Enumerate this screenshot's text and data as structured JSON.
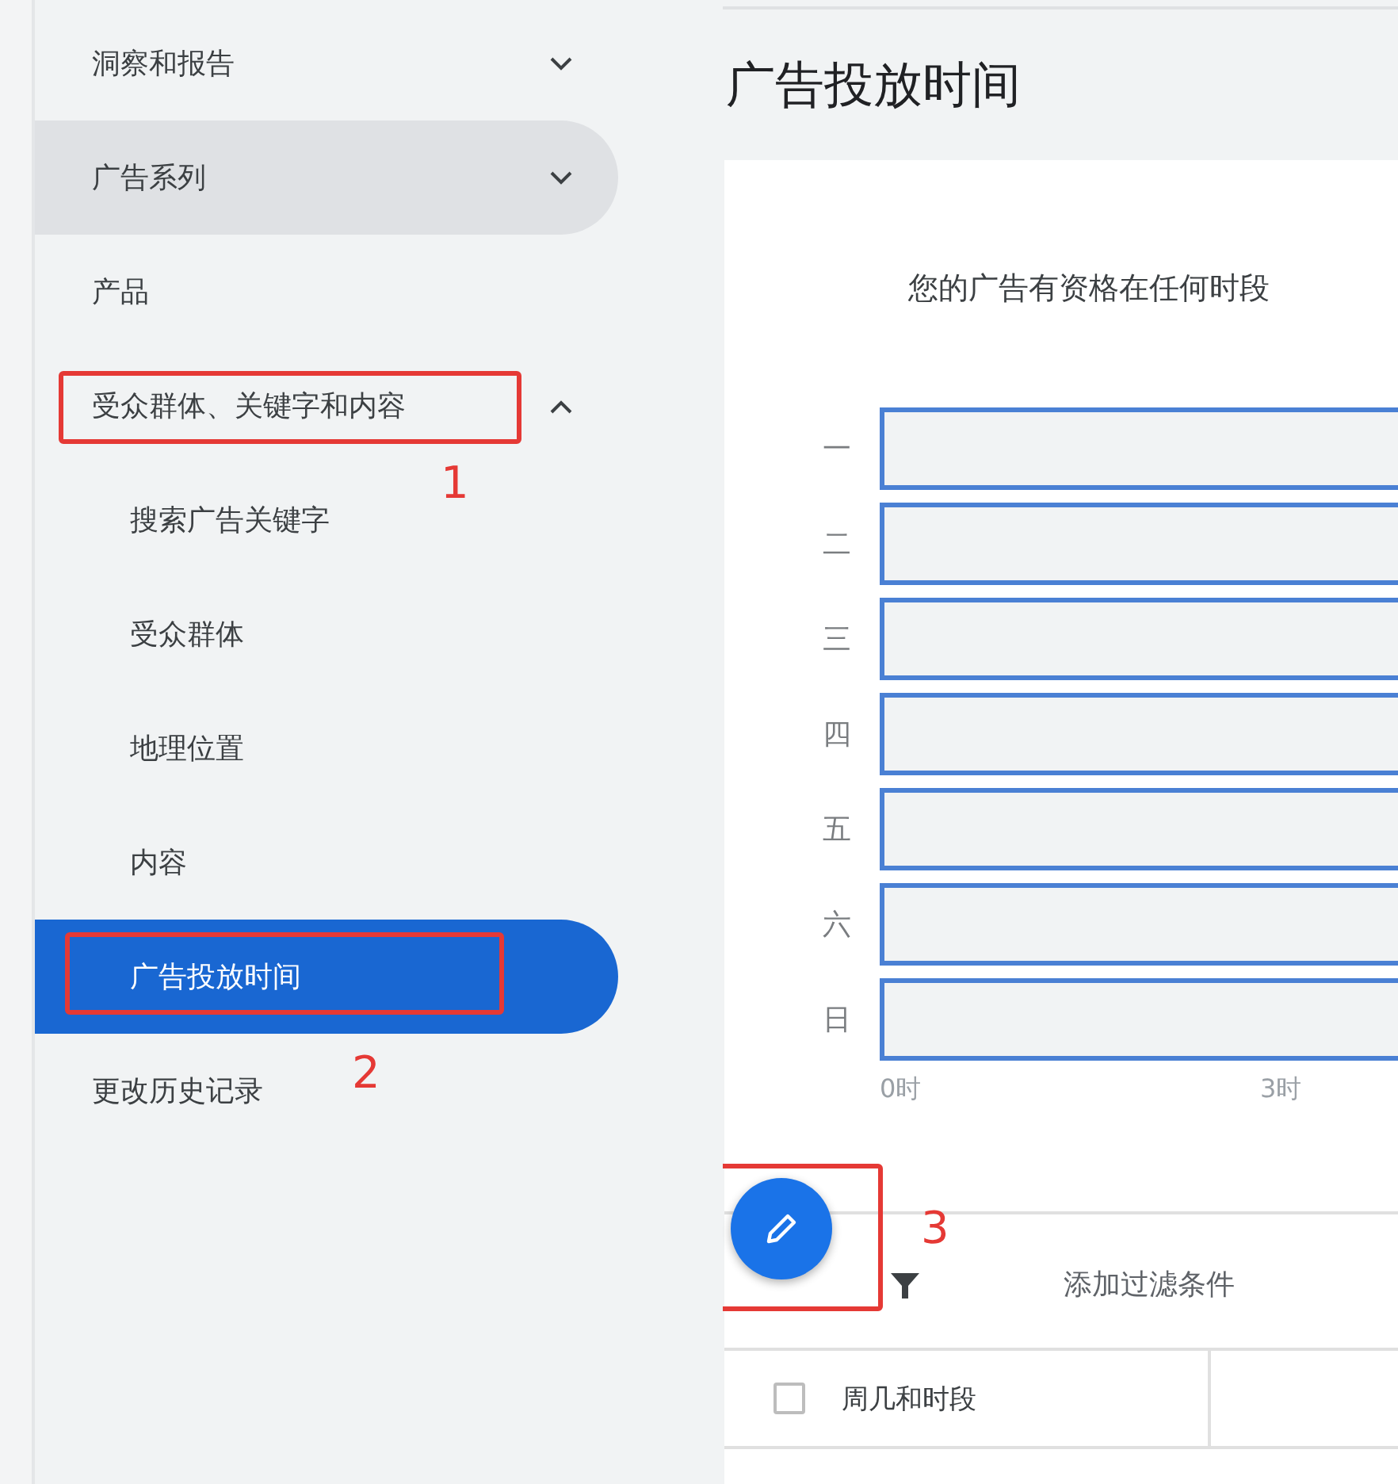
{
  "sidebar": {
    "items": [
      {
        "label": "洞察和报告",
        "expanded": false,
        "selected": false,
        "highlighted": false
      },
      {
        "label": "广告系列",
        "expanded": false,
        "selected": false,
        "highlighted": true
      },
      {
        "label": "产品",
        "selected": false,
        "highlighted": false
      },
      {
        "label": "受众群体、关键字和内容",
        "expanded": true,
        "selected": false,
        "highlighted": false,
        "annotation": "1",
        "children": [
          {
            "label": "搜索广告关键字",
            "selected": false,
            "highlighted": false
          },
          {
            "label": "受众群体",
            "selected": false,
            "highlighted": false
          },
          {
            "label": "地理位置",
            "selected": false,
            "highlighted": false
          },
          {
            "label": "内容",
            "selected": false,
            "highlighted": false
          },
          {
            "label": "广告投放时间",
            "selected": true,
            "highlighted": false,
            "annotation": "2"
          }
        ]
      },
      {
        "label": "更改历史记录",
        "selected": false,
        "highlighted": false
      }
    ]
  },
  "main": {
    "title": "广告投放时间",
    "card": {
      "message": "您的广告有资格在任何时段",
      "days": [
        "一",
        "二",
        "三",
        "四",
        "五",
        "六",
        "日"
      ],
      "time_ticks": [
        "0时",
        "3时"
      ],
      "edit_button": {
        "annotation": "3"
      },
      "filter": {
        "label": "添加过滤条件"
      },
      "table": {
        "select_all_checked": false,
        "columns": [
          "周几和时段"
        ]
      }
    }
  }
}
